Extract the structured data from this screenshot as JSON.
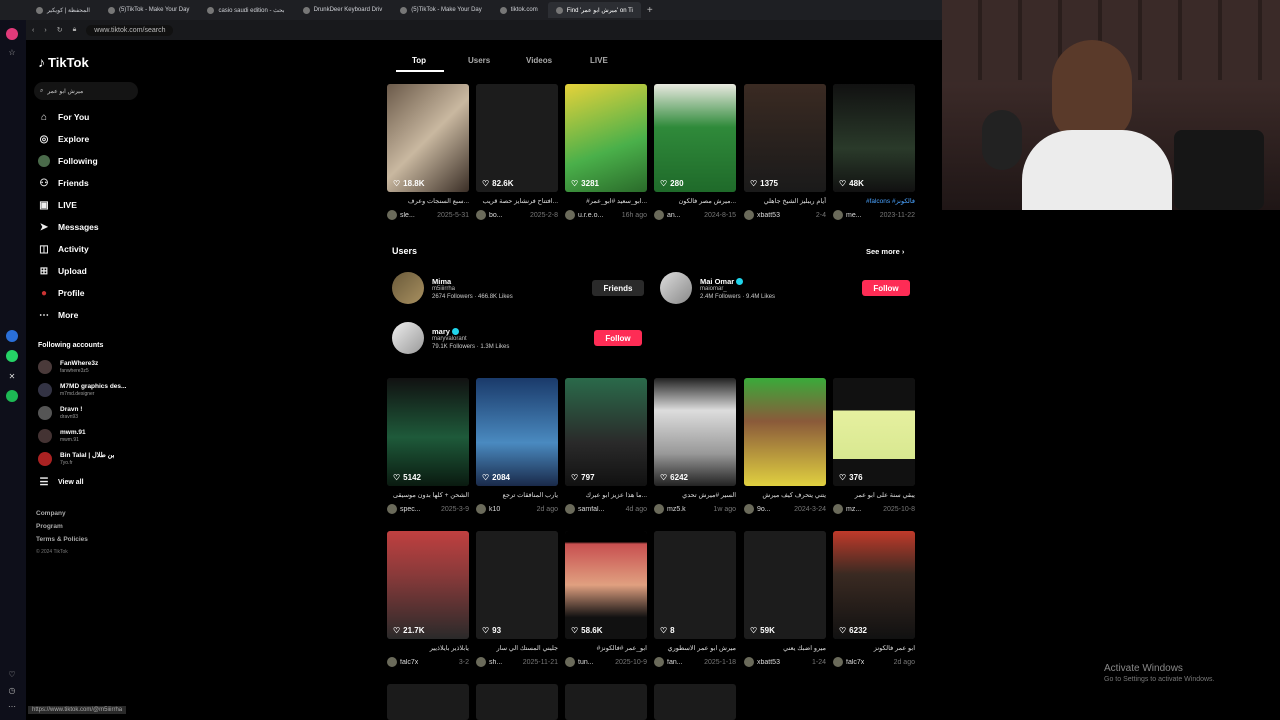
{
  "browser": {
    "tabs": [
      {
        "label": "المحفظة | كويكير",
        "active": false
      },
      {
        "label": "(5)TikTok - Make Your Day",
        "active": false
      },
      {
        "label": "casio saudi edition - بحث",
        "active": false
      },
      {
        "label": "DrunkDeer Keyboard Driv",
        "active": false
      },
      {
        "label": "(5)TikTok - Make Your Day",
        "active": false
      },
      {
        "label": "tiktok.com",
        "active": false
      },
      {
        "label": "Find 'ميرش ابو عمر' on Ti",
        "active": true
      }
    ],
    "new_tab": "+",
    "url": "www.tiktok.com/search",
    "status_url": "https://www.tiktok.com/@m5iiirrha"
  },
  "sidebar": {
    "logo": "TikTok",
    "search_value": "ميرش ابو عمر",
    "nav": [
      {
        "label": "For You",
        "icon": "home-icon"
      },
      {
        "label": "Explore",
        "icon": "compass-icon"
      },
      {
        "label": "Following",
        "icon": "following-avatar-icon"
      },
      {
        "label": "Friends",
        "icon": "friends-icon"
      },
      {
        "label": "LIVE",
        "icon": "live-icon"
      },
      {
        "label": "Messages",
        "icon": "messages-icon"
      },
      {
        "label": "Activity",
        "icon": "activity-icon"
      },
      {
        "label": "Upload",
        "icon": "upload-icon"
      },
      {
        "label": "Profile",
        "icon": "profile-icon"
      },
      {
        "label": "More",
        "icon": "more-icon"
      }
    ],
    "following_header": "Following accounts",
    "following": [
      {
        "name": "FanWhere3z",
        "handle": "fanwhere3z5"
      },
      {
        "name": "M7MD graphics des...",
        "handle": "m7md.designer"
      },
      {
        "name": "Dravn !",
        "handle": "dravn93"
      },
      {
        "name": "mwm.91",
        "handle": "mwm.91"
      },
      {
        "name": "Bin Talal | بن طلال",
        "handle": "7yo.fr"
      }
    ],
    "view_all": "View all",
    "footer": [
      "Company",
      "Program",
      "Terms & Policies"
    ],
    "copyright": "© 2024 TikTok"
  },
  "tabs": [
    "Top",
    "Users",
    "Videos",
    "LIVE"
  ],
  "row1": [
    {
      "likes": "18.8K",
      "caption": "سبع السنجات وعرف...",
      "user": "sle...",
      "date": "2025-5-31"
    },
    {
      "likes": "82.6K",
      "caption": "افتتاح فرنشايز حصة قريب...",
      "user": "bo...",
      "date": "2025-2-8"
    },
    {
      "likes": "3281",
      "caption": "#ابو_سعيد #ابو_عمر...",
      "user": "u.r.e.o...",
      "date": "16h ago"
    },
    {
      "likes": "280",
      "caption": "ميرش مصر فالكون...",
      "user": "an...",
      "date": "2024-8-15"
    },
    {
      "likes": "1375",
      "caption": "أيام ريبليز الشيخ جاهلي",
      "user": "xbatt53",
      "date": "2-4"
    },
    {
      "likes": "48K",
      "caption": "#falcons #فالكونز",
      "user": "me...",
      "date": "2023-11-22"
    }
  ],
  "users_section": {
    "title": "Users",
    "see_more": "See more",
    "users": [
      {
        "name": "Mima",
        "handle": "m5iiirrha",
        "followers": "2674 Followers",
        "likes": "466.8K Likes",
        "verified": false,
        "button": "Friends"
      },
      {
        "name": "Mai Omar",
        "handle": "maiomar_",
        "followers": "2.4M Followers",
        "likes": "9.4M Likes",
        "verified": true,
        "button": "Follow"
      },
      {
        "name": "mary",
        "handle": "maryvalorant",
        "followers": "79.1K Followers",
        "likes": "1.3M Likes",
        "verified": true,
        "button": "Follow"
      }
    ]
  },
  "row2": [
    {
      "likes": "5142",
      "caption": "الشحن + كلها بدون موسيقى",
      "user": "spec...",
      "date": "2025-3-9"
    },
    {
      "likes": "2084",
      "caption": "يارب المنافقات ترجع",
      "user": "k10",
      "date": "2d ago"
    },
    {
      "likes": "797",
      "caption": "ما هذا عزيز ابو عبرك...",
      "user": "samfal...",
      "date": "4d ago"
    },
    {
      "likes": "6242",
      "caption": "السير #ميرش تحدي",
      "user": "mz5.k",
      "date": "1w ago"
    },
    {
      "likes": "",
      "caption": "يتني يتحرف كيف ميرش",
      "user": "9o...",
      "date": "2024-3-24"
    },
    {
      "likes": "376",
      "caption": "يبقي سنة على ابو عمر",
      "user": "mz...",
      "date": "2025-10-8"
    }
  ],
  "row3": [
    {
      "likes": "21.7K",
      "caption": "يابلاذير بايلاذيير",
      "user": "falc7x",
      "date": "3-2"
    },
    {
      "likes": "93",
      "caption": "جليني المستك الي سار",
      "user": "sh...",
      "date": "2025-11-21"
    },
    {
      "likes": "58.6K",
      "caption": "#ابو_عمر #فالكونز",
      "user": "tun...",
      "date": "2025-10-9"
    },
    {
      "likes": "8",
      "caption": "ميرش ابو عمر الاسطوري",
      "user": "fan...",
      "date": "2025-1-18"
    },
    {
      "likes": "59K",
      "caption": "ميرو اضبك يعني",
      "user": "xbatt53",
      "date": "1-24"
    },
    {
      "likes": "6232",
      "caption": "ابو عمر فالكونز",
      "user": "falc7x",
      "date": "2d ago"
    }
  ],
  "windows": {
    "title": "Activate Windows",
    "subtitle": "Go to Settings to activate Windows."
  },
  "colors": {
    "accent": "#fe2c55",
    "verified": "#20d5ec",
    "bg": "#000000"
  }
}
